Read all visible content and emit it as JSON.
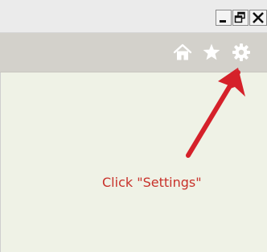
{
  "window": {
    "controls": [
      {
        "name": "minimize",
        "icon": "minimize-icon"
      },
      {
        "name": "restore",
        "icon": "restore-icon"
      },
      {
        "name": "close",
        "icon": "close-icon"
      }
    ]
  },
  "toolbar": {
    "icons": [
      {
        "name": "home",
        "icon": "home-icon"
      },
      {
        "name": "favorites",
        "icon": "star-icon"
      },
      {
        "name": "settings",
        "icon": "gear-icon"
      }
    ]
  },
  "annotation": {
    "text": "Click \"Settings\"",
    "color": "#c8312a"
  },
  "colors": {
    "toolbar": "#d3d1cb",
    "content": "#eff2e6",
    "titlebar": "#ebebeb"
  }
}
